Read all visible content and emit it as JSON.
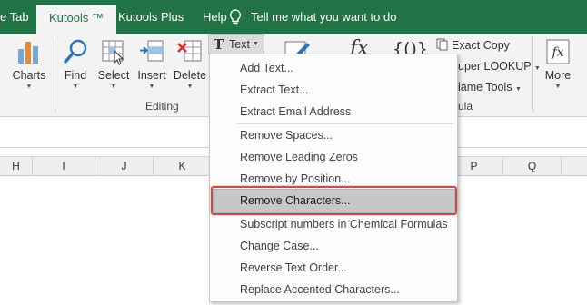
{
  "tabs": [
    {
      "label": "e Tab",
      "active": false
    },
    {
      "label": "Kutools ™",
      "active": true
    },
    {
      "label": "Kutools Plus",
      "active": false
    },
    {
      "label": "Help",
      "active": false
    }
  ],
  "tell_me": "Tell me what you want to do",
  "ribbon": {
    "buttons": {
      "charts": "Charts",
      "find": "Find",
      "select": "Select",
      "insert": "Insert",
      "delete": "Delete",
      "text": "Text",
      "more": "More"
    },
    "small_buttons": {
      "exact_copy": "Exact Copy",
      "super_lookup": "uper LOOKUP",
      "name_tools": "lame Tools"
    },
    "groups": {
      "editing": "Editing",
      "formula": "ula"
    }
  },
  "columns": [
    "H",
    "I",
    "J",
    "K",
    "P",
    "Q"
  ],
  "text_menu": {
    "items": [
      "Add Text...",
      "Extract Text...",
      "Extract Email Address",
      "Remove Spaces...",
      "Remove Leading Zeros",
      "Remove by Position...",
      "Remove Characters...",
      "Subscript numbers in Chemical Formulas",
      "Change Case...",
      "Reverse Text Order...",
      "Replace Accented Characters..."
    ],
    "highlighted": "Remove Characters..."
  },
  "colors": {
    "ribbon_green": "#217346",
    "highlight_border": "#c0504d"
  }
}
